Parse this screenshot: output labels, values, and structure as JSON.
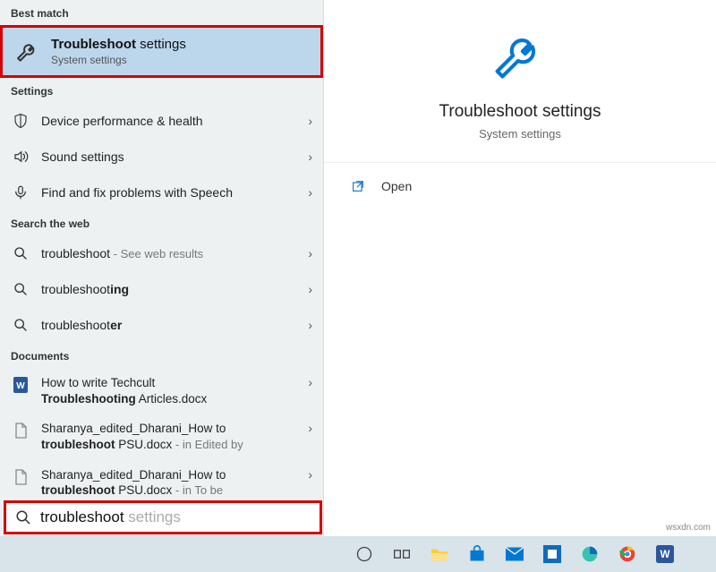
{
  "sections": {
    "best_match": "Best match",
    "settings": "Settings",
    "web": "Search the web",
    "documents": "Documents"
  },
  "best_match": {
    "title_bold": "Troubleshoot",
    "title_rest": " settings",
    "subtitle": "System settings"
  },
  "settings_items": [
    {
      "label": "Device performance & health"
    },
    {
      "label": "Sound settings"
    },
    {
      "label": "Find and fix problems with Speech"
    }
  ],
  "web_items": [
    {
      "prefix": "troubleshoot",
      "bold": "",
      "suffix": " - See web results",
      "suffix_muted": true
    },
    {
      "prefix": "troubleshoot",
      "bold": "ing",
      "suffix": ""
    },
    {
      "prefix": "troubleshoot",
      "bold": "er",
      "suffix": ""
    }
  ],
  "documents": [
    {
      "line1": "How to write Techcult",
      "bold": "Troubleshooting",
      "line2_rest": " Articles.docx",
      "tail": "",
      "icon": "word"
    },
    {
      "line1": "Sharanya_edited_Dharani_How to",
      "bold": "troubleshoot",
      "line2_rest": " PSU.docx",
      "tail": " - in Edited by",
      "icon": "doc"
    },
    {
      "line1": "Sharanya_edited_Dharani_How to",
      "bold": "troubleshoot",
      "line2_rest": " PSU.docx",
      "tail": " - in To be",
      "icon": "doc"
    }
  ],
  "preview": {
    "title": "Troubleshoot settings",
    "subtitle": "System settings",
    "open_label": "Open"
  },
  "search": {
    "typed": "troubleshoot",
    "ghost": " settings"
  },
  "watermark": "wsxdn.com"
}
